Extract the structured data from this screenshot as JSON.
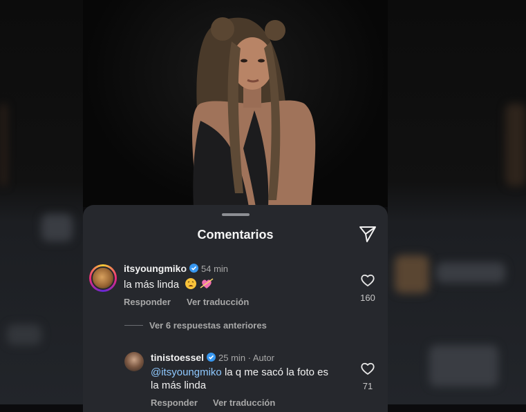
{
  "sheet": {
    "title": "Comentarios"
  },
  "comments": [
    {
      "username": "itsyoungmiko",
      "time": "54 min",
      "text": "la más linda",
      "emojis": [
        "weary-face-emoji",
        "heart-with-arrow-emoji"
      ],
      "reply_label": "Responder",
      "translate_label": "Ver traducción",
      "likes": "160"
    },
    {
      "username": "tinistoessel",
      "time": "25 min · Autor",
      "mention": "@itsyoungmiko",
      "text_line1": " la q me sacó la foto es",
      "text_line2": "la más linda",
      "reply_label": "Responder",
      "translate_label": "Ver traducción",
      "likes": "71"
    }
  ],
  "view_replies": "Ver 6 respuestas anteriores",
  "colors": {
    "sheet_bg": "#26282d",
    "verified": "#3797f0",
    "secondary_text": "#a8a8a8"
  }
}
